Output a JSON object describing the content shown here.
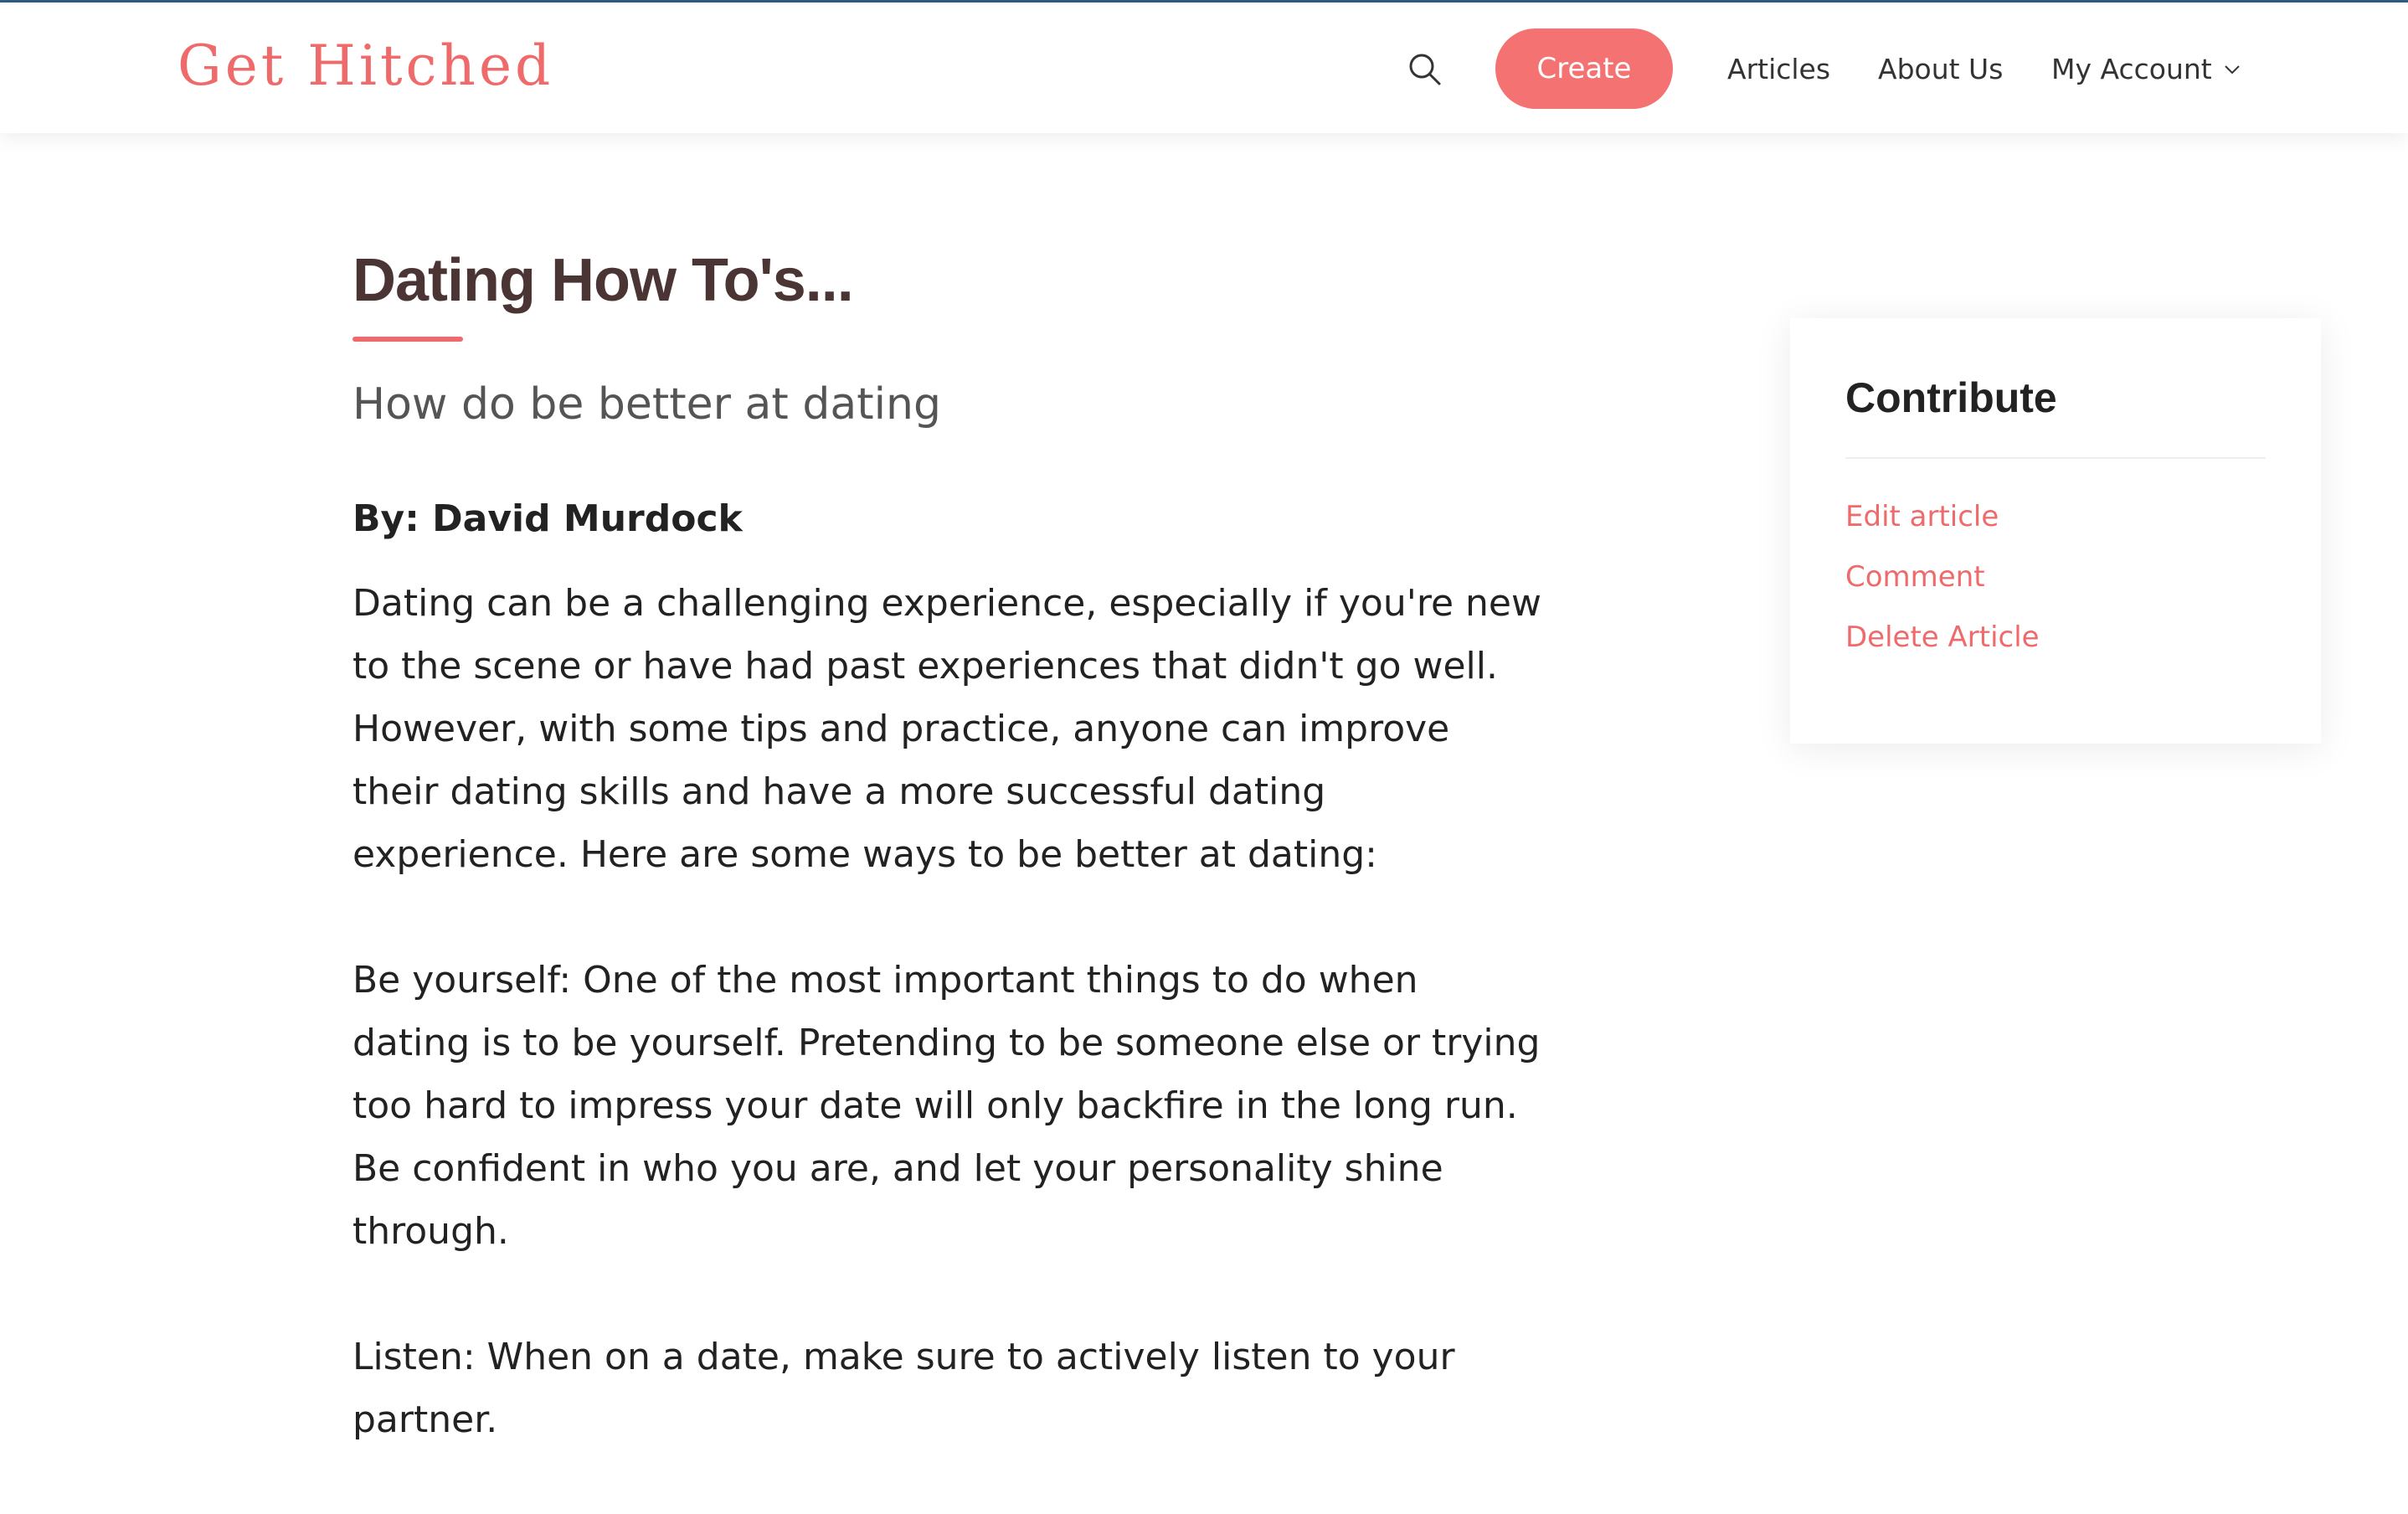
{
  "header": {
    "logo": "Get Hitched",
    "search_icon": "search-icon",
    "create_label": "Create",
    "nav": {
      "articles": "Articles",
      "about": "About Us",
      "account": "My Account",
      "account_icon": "chevron-down-icon"
    }
  },
  "article": {
    "title": "Dating How To's...",
    "subtitle": "How do be better at dating",
    "byline": "By: David Murdock",
    "paragraphs": [
      "Dating can be a challenging experience, especially if you're new to the scene or have had past experiences that didn't go well. However, with some tips and practice, anyone can improve their dating skills and have a more successful dating experience. Here are some ways to be better at dating:",
      "Be yourself: One of the most important things to do when dating is to be yourself. Pretending to be someone else or trying too hard to impress your date will only backfire in the long run. Be confident in who you are, and let your personality shine through.",
      "Listen: When on a date, make sure to actively listen to your partner."
    ]
  },
  "sidebar": {
    "title": "Contribute",
    "links": {
      "edit": "Edit article",
      "comment": "Comment",
      "delete": "Delete Article"
    }
  },
  "colors": {
    "accent": "#ef6b6b",
    "create_button": "#f47272",
    "title_text": "#4a3434",
    "top_rule": "#2e5d86"
  }
}
